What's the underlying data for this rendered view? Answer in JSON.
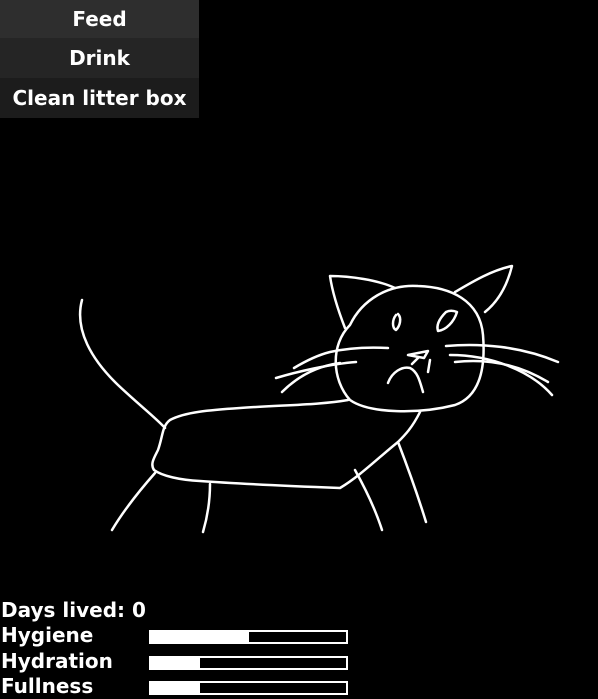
{
  "menu": {
    "feed_label": "Feed",
    "drink_label": "Drink",
    "clean_label": "Clean litter box"
  },
  "pet": {
    "icon": "cat-drawing"
  },
  "stats": {
    "days_label": "Days lived: 0",
    "bars": [
      {
        "label": "Hygiene",
        "value": 0.5
      },
      {
        "label": "Hydration",
        "value": 0.25
      },
      {
        "label": "Fullness",
        "value": 0.25
      }
    ]
  },
  "colors": {
    "background": "#000000",
    "foreground": "#ffffff",
    "button": "#2e2e2e"
  }
}
